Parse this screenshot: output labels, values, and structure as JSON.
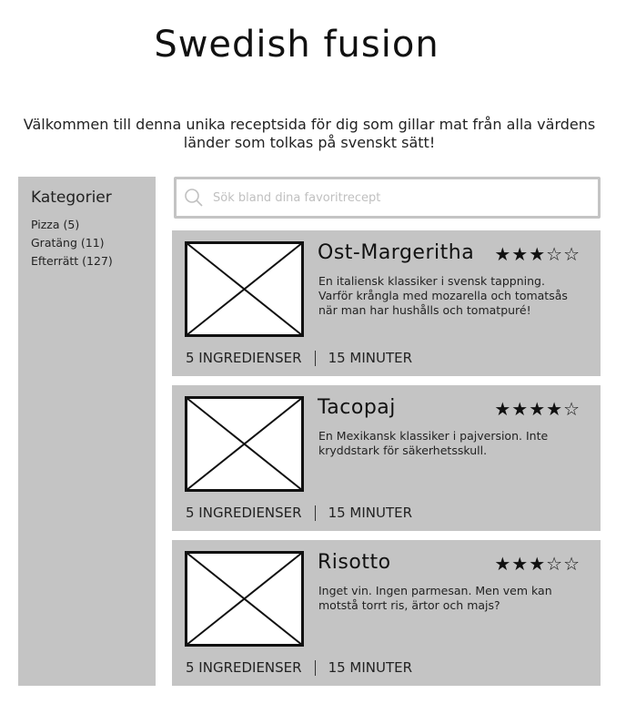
{
  "page": {
    "title": "Swedish fusion",
    "intro": "Välkommen till denna unika receptsida för dig som gillar mat från alla värdens länder som tolkas på svenskt sätt!"
  },
  "sidebar": {
    "heading": "Kategorier",
    "items": [
      {
        "label": "Pizza (5)"
      },
      {
        "label": "Gratäng (11)"
      },
      {
        "label": "Efterrätt (127)"
      }
    ]
  },
  "search": {
    "placeholder": "Sök bland dina favoritrecept",
    "icon": "search-icon"
  },
  "recipes": [
    {
      "name": "Ost-Margeritha",
      "rating": 3,
      "rating_max": 5,
      "stars": "★★★☆☆",
      "description": "En italiensk klassiker i svensk tappning. Varför krångla med mozarella och tomatsås när man har hushålls och tomatpuré!",
      "ingredients": "5 INGREDIENSER",
      "time": "15 MINUTER"
    },
    {
      "name": "Tacopaj",
      "rating": 4,
      "rating_max": 5,
      "stars": "★★★★☆",
      "description": "En Mexikansk klassiker i pajversion. Inte kryddstark för säkerhetsskull.",
      "ingredients": "5 INGREDIENSER",
      "time": "15 MINUTER"
    },
    {
      "name": "Risotto",
      "rating": 3,
      "rating_max": 5,
      "stars": "★★★☆☆",
      "description": "Inget vin. Ingen parmesan. Men vem kan motstå torrt ris, ärtor och majs?",
      "ingredients": "5 INGREDIENSER",
      "time": "15 MINUTER"
    }
  ],
  "colors": {
    "panel": "#c4c4c4",
    "text": "#111111"
  }
}
